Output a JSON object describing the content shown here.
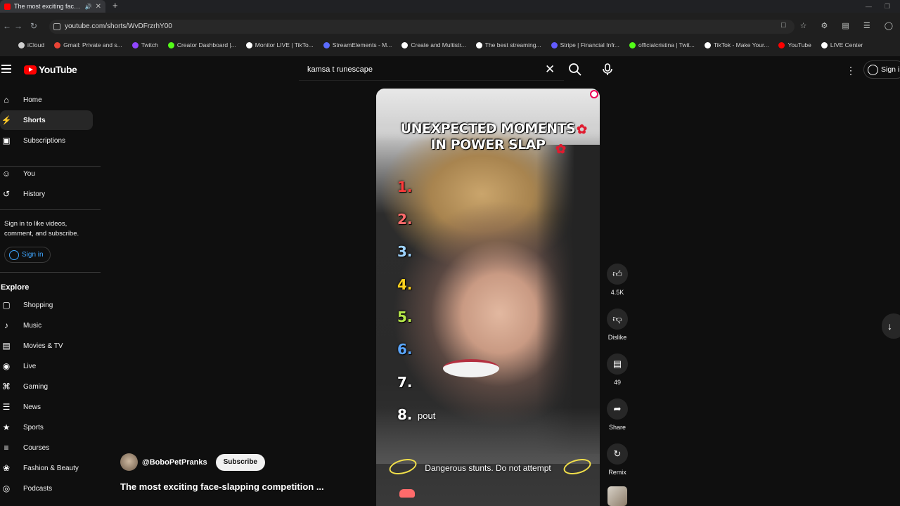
{
  "browser": {
    "tab_title": "The most exciting face-slap",
    "url": "youtube.com/shorts/WvDFrzrhY00",
    "bookmarks": [
      {
        "label": "iCloud",
        "color": "#cfcfcf"
      },
      {
        "label": "Gmail: Private and s...",
        "color": "#ea4335"
      },
      {
        "label": "Twitch",
        "color": "#9146ff"
      },
      {
        "label": "Creator Dashboard |...",
        "color": "#53fc18"
      },
      {
        "label": "Monitor LIVE | TikTo...",
        "color": "#ffffff"
      },
      {
        "label": "StreamElements - M...",
        "color": "#5b6cff"
      },
      {
        "label": "Create and Multistr...",
        "color": "#ffffff"
      },
      {
        "label": "The best streaming...",
        "color": "#ffffff"
      },
      {
        "label": "Stripe | Financial Infr...",
        "color": "#635bff"
      },
      {
        "label": "officialcristina | Twit...",
        "color": "#53fc18"
      },
      {
        "label": "TikTok - Make Your...",
        "color": "#ffffff"
      },
      {
        "label": "YouTube",
        "color": "#ff0000"
      },
      {
        "label": "LIVE Center",
        "color": "#ffffff"
      }
    ]
  },
  "header": {
    "logo_text": "YouTube",
    "search_value": "kamsa t runescape",
    "signin_label": "Sign in"
  },
  "sidebar": {
    "items": [
      {
        "label": "Home",
        "icon": "home-icon"
      },
      {
        "label": "Shorts",
        "icon": "shorts-icon"
      },
      {
        "label": "Subscriptions",
        "icon": "subscriptions-icon"
      },
      {
        "label": "You",
        "icon": "you-icon"
      },
      {
        "label": "History",
        "icon": "history-icon"
      }
    ],
    "signin_message": "Sign in to like videos, comment, and subscribe.",
    "signin_button": "Sign in",
    "explore_heading": "Explore",
    "explore_items": [
      {
        "label": "Shopping",
        "icon": "shopping-icon"
      },
      {
        "label": "Music",
        "icon": "music-icon"
      },
      {
        "label": "Movies & TV",
        "icon": "movies-icon"
      },
      {
        "label": "Live",
        "icon": "live-icon"
      },
      {
        "label": "Gaming",
        "icon": "gaming-icon"
      },
      {
        "label": "News",
        "icon": "news-icon"
      },
      {
        "label": "Sports",
        "icon": "sports-icon"
      },
      {
        "label": "Courses",
        "icon": "courses-icon"
      },
      {
        "label": "Fashion & Beauty",
        "icon": "fashion-icon"
      },
      {
        "label": "Podcasts",
        "icon": "podcasts-icon"
      }
    ]
  },
  "video": {
    "title_line1": "UNEXPECTED MOMENTS",
    "title_line2": "IN POWER SLAP",
    "list": [
      {
        "num": "1.",
        "color": "#ff3b3b"
      },
      {
        "num": "2.",
        "color": "#ff6b6b"
      },
      {
        "num": "3.",
        "color": "#9fd4ff"
      },
      {
        "num": "4.",
        "color": "#ffd21e"
      },
      {
        "num": "5.",
        "color": "#b6e84a"
      },
      {
        "num": "6.",
        "color": "#5aa6ff"
      },
      {
        "num": "7.",
        "color": "#ffffff"
      },
      {
        "num": "8.",
        "color": "#ffffff"
      }
    ],
    "item8_text": "pout",
    "warning": "Dangerous stunts. Do not attempt"
  },
  "actions": {
    "like_count": "4.5K",
    "dislike_label": "Dislike",
    "comment_count": "49",
    "share_label": "Share",
    "remix_label": "Remix"
  },
  "channel": {
    "handle": "@BoboPetPranks",
    "subscribe_label": "Subscribe",
    "short_title": "The most exciting face-slapping competition ..."
  }
}
